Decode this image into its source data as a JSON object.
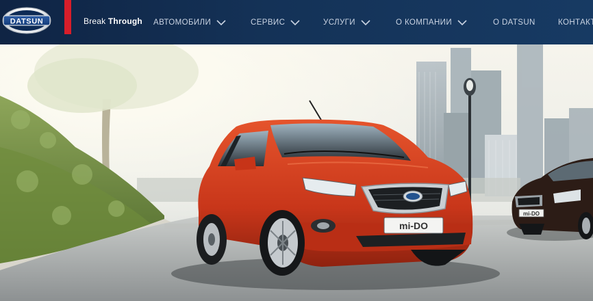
{
  "brand": {
    "logo_text": "DATSUN",
    "tagline_light": "Break",
    "tagline_bold": "Through",
    "accent_color": "#d81e2a"
  },
  "nav": {
    "items": [
      {
        "label": "АВТОМОБИЛИ",
        "has_dropdown": true
      },
      {
        "label": "СЕРВИС",
        "has_dropdown": true
      },
      {
        "label": "УСЛУГИ",
        "has_dropdown": true
      },
      {
        "label": "О КОМПАНИИ",
        "has_dropdown": true
      },
      {
        "label": "О DATSUN",
        "has_dropdown": false
      },
      {
        "label": "КОНТАКТ",
        "has_dropdown": false
      }
    ]
  },
  "hero": {
    "car_main_badge": "mi-DO",
    "car_main_color": "#d23a1c",
    "car_second_badge": "mi-DO",
    "car_second_color": "#2a1b16"
  }
}
